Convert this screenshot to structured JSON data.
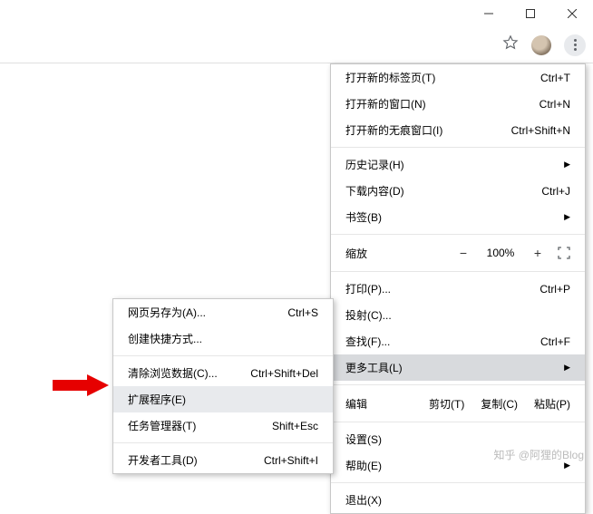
{
  "mainMenu": {
    "newTab": {
      "label": "打开新的标签页(T)",
      "shortcut": "Ctrl+T"
    },
    "newWindow": {
      "label": "打开新的窗口(N)",
      "shortcut": "Ctrl+N"
    },
    "newIncognito": {
      "label": "打开新的无痕窗口(I)",
      "shortcut": "Ctrl+Shift+N"
    },
    "history": {
      "label": "历史记录(H)"
    },
    "downloads": {
      "label": "下载内容(D)",
      "shortcut": "Ctrl+J"
    },
    "bookmarks": {
      "label": "书签(B)"
    },
    "zoom": {
      "label": "缩放",
      "value": "100%"
    },
    "print": {
      "label": "打印(P)...",
      "shortcut": "Ctrl+P"
    },
    "cast": {
      "label": "投射(C)..."
    },
    "find": {
      "label": "查找(F)...",
      "shortcut": "Ctrl+F"
    },
    "moreTools": {
      "label": "更多工具(L)"
    },
    "edit": {
      "label": "编辑",
      "cut": "剪切(T)",
      "copy": "复制(C)",
      "paste": "粘贴(P)"
    },
    "settings": {
      "label": "设置(S)"
    },
    "help": {
      "label": "帮助(E)"
    },
    "exit": {
      "label": "退出(X)"
    }
  },
  "subMenu": {
    "savePageAs": {
      "label": "网页另存为(A)...",
      "shortcut": "Ctrl+S"
    },
    "createShortcut": {
      "label": "创建快捷方式..."
    },
    "clearBrowsing": {
      "label": "清除浏览数据(C)...",
      "shortcut": "Ctrl+Shift+Del"
    },
    "extensions": {
      "label": "扩展程序(E)"
    },
    "taskManager": {
      "label": "任务管理器(T)",
      "shortcut": "Shift+Esc"
    },
    "devTools": {
      "label": "开发者工具(D)",
      "shortcut": "Ctrl+Shift+I"
    }
  },
  "watermark": "知乎 @阿狸的Blog"
}
